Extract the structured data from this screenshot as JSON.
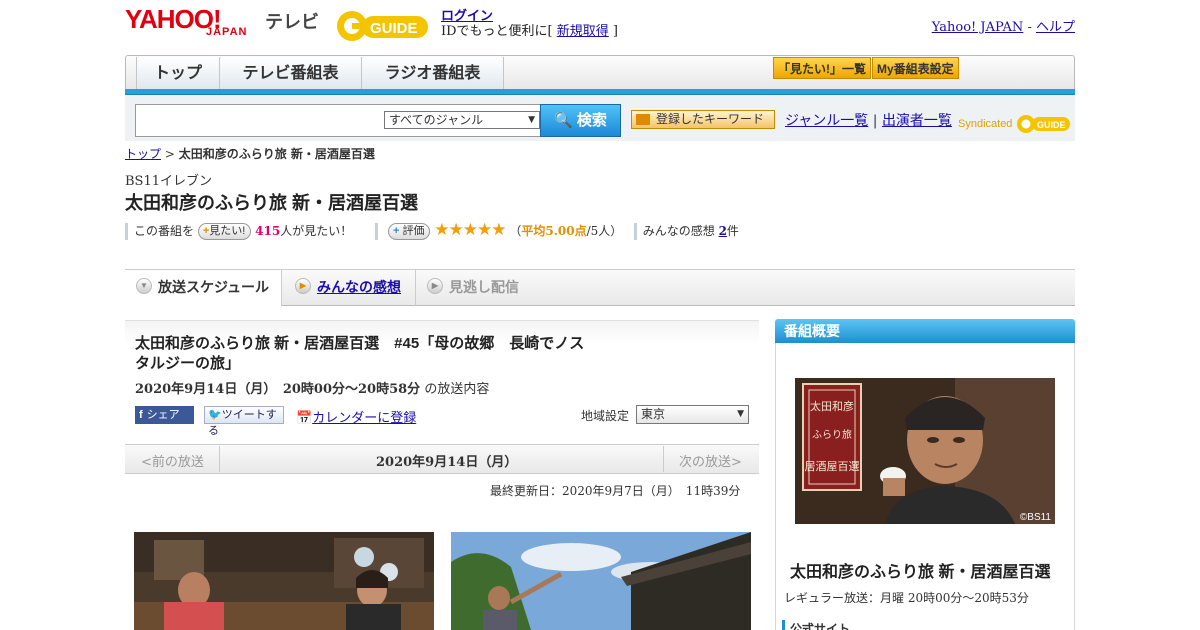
{
  "header": {
    "yahoo_logo": "YAHOO!",
    "japan_logo": "JAPAN",
    "service_name": "テレビ",
    "gguide_logo": "GUIDE",
    "login_label": "ログイン",
    "login_message_pre": "IDでもっと便利に[ ",
    "signup_label": "新規取得",
    "login_message_post": " ]",
    "yahoo_japan_link": "Yahoo! JAPAN",
    "help_link": "ヘルプ",
    "separator": " - "
  },
  "nav": {
    "tabs": [
      "トップ",
      "テレビ番組表",
      "ラジオ番組表"
    ],
    "want_list": "「見たい!」一覧",
    "my_schedule": "My番組表設定"
  },
  "search": {
    "genre_selected": "すべてのジャンル",
    "button": "検索",
    "keywords_button": "登録したキーワード",
    "genre_list": "ジャンル一覧",
    "performer_list": "出演者一覧",
    "syndicated": "Syndicated",
    "divider": "|"
  },
  "breadcrumb": {
    "top": "トップ",
    "sep": " > ",
    "current": "太田和彦のふらり旅 新・居酒屋百選"
  },
  "program": {
    "channel": "BS11イレブン",
    "title": "太田和彦のふらり旅 新・居酒屋百選",
    "want_prefix": "この番組を",
    "want_button": "見たい!",
    "want_count": "415",
    "want_suffix": "人が見たい！",
    "rate_button": "評価",
    "stars": "★★★★★",
    "rating_open": "（",
    "rating_avg": "平均5.00点",
    "rating_people": "/5人",
    "rating_close": "）",
    "reviews_prefix": "みんなの感想 ",
    "reviews_count": "2",
    "reviews_suffix": "件"
  },
  "subtabs": {
    "schedule": "放送スケジュール",
    "reviews": "みんなの感想",
    "missed": "見逃し配信"
  },
  "episode": {
    "title": "太田和彦のふらり旅 新・居酒屋百選　#45「母の故郷　長崎でノスタルジーの旅」",
    "datetime": "2020年9月14日（月）　20時00分～20時58分",
    "datetime_suffix": "の放送内容",
    "share": "シェア",
    "tweet": "ツイートする",
    "calendar": "カレンダーに登録",
    "region_label": "地域設定",
    "region": "東京"
  },
  "datenav": {
    "prev": "<前の放送",
    "current": "2020年9月14日（月）",
    "next": "次の放送>",
    "updated": "最終更新日：2020年9月7日（月）　11時39分"
  },
  "sidebar": {
    "heading": "番組概要",
    "photo_credit": "©BS11",
    "title": "太田和彦のふらり旅 新・居酒屋百選",
    "regular": "レギュラー放送：月曜 20時00分～20時53分",
    "official_site": "公式サイト"
  },
  "colors": {
    "accent_blue": "#2a9ed8",
    "yahoo_red": "#e0000f",
    "want_count": "#e0006c",
    "rating": "#e09000"
  }
}
